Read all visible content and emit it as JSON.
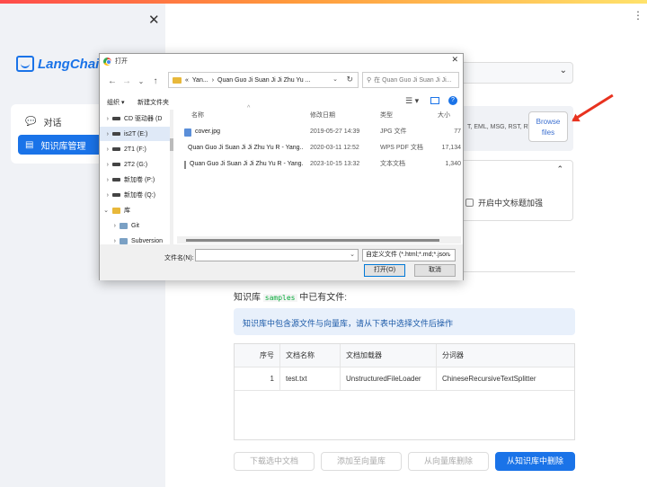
{
  "sidebar": {
    "logo_text": "LangChain-",
    "items": [
      {
        "label": "对话",
        "icon": "chat-bubble-icon"
      },
      {
        "label": "知识库管理",
        "icon": "database-icon"
      }
    ]
  },
  "main": {
    "upload_types": "T, EML, MSG, RST, RTF,",
    "browse_label_1": "Browse",
    "browse_label_2": "files",
    "checkbox_label": "开启中文标题加强",
    "kb_prefix": "知识库",
    "kb_name": "samples",
    "kb_suffix": "中已有文件:",
    "info_text": "知识库中包含源文件与向量库，请从下表中选择文件后操作",
    "table": {
      "headers": [
        "序号",
        "文档名称",
        "文档加载器",
        "分词器"
      ],
      "rows": [
        [
          "1",
          "test.txt",
          "UnstructuredFileLoader",
          "ChineseRecursiveTextSplitter"
        ]
      ]
    },
    "buttons": [
      "下载选中文档",
      "添加至向量库",
      "从向量库删除",
      "从知识库中删除"
    ]
  },
  "dialog": {
    "title": "打开",
    "address_prefix": "«",
    "address_part1": "Yan...",
    "address_sep": "›",
    "address_part2": "Quan Guo Ji Suan Ji Ji Zhu Yu ...",
    "search_placeholder": "在 Quan Guo Ji Suan Ji Ji...",
    "toolbar": {
      "organize": "组织 ▾",
      "new_folder": "新建文件夹"
    },
    "tree": [
      {
        "label": "CD 驱动器 (D",
        "type": "drive"
      },
      {
        "label": "is2T (E:)",
        "type": "drive",
        "selected": true
      },
      {
        "label": "2T1 (F:)",
        "type": "drive"
      },
      {
        "label": "2T2 (G:)",
        "type": "drive"
      },
      {
        "label": "新加卷 (P:)",
        "type": "drive"
      },
      {
        "label": "新加卷 (Q:)",
        "type": "drive"
      },
      {
        "label": "库",
        "type": "folder",
        "expanded": true
      },
      {
        "label": "Git",
        "type": "git"
      },
      {
        "label": "Subversion",
        "type": "git"
      }
    ],
    "columns": {
      "name": "名称",
      "date": "修改日期",
      "type": "类型",
      "size": "大小"
    },
    "files": [
      {
        "name": "cover.jpg",
        "date": "2019-05-27 14:39",
        "type": "JPG 文件",
        "size": "77",
        "icon": "jpg"
      },
      {
        "name": "Quan Guo Ji Suan Ji Ji Zhu Yu R - Yang...",
        "date": "2020-03-11 12:52",
        "type": "WPS PDF 文档",
        "size": "17,134",
        "icon": "pdf"
      },
      {
        "name": "Quan Guo Ji Suan Ji Ji Zhu Yu R - Yang...",
        "date": "2023-10-15 13:32",
        "type": "文本文档",
        "size": "1,340",
        "icon": "txt"
      }
    ],
    "filename_label": "文件名(N):",
    "filetype": "自定义文件 (*.html;*.md;*.json",
    "open_button": "打开(O)",
    "cancel_button": "取消"
  }
}
